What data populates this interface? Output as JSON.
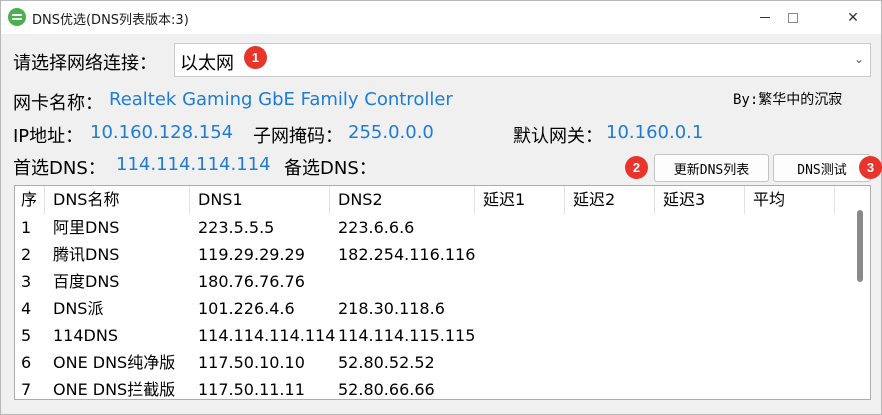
{
  "window": {
    "title": "DNS优选(DNS列表版本:3)",
    "icons": {
      "app": "dns-app-icon",
      "minimize": "minimize-icon",
      "maximize": "maximize-icon",
      "close": "close-icon"
    }
  },
  "adapter": {
    "label": "请选择网络连接：",
    "selected": "以太网",
    "badge": "1"
  },
  "nic": {
    "label": "网卡名称：",
    "value": "Realtek Gaming GbE Family Controller"
  },
  "author": "By:繁华中的沉寂",
  "ip": {
    "ip_label": "IP地址：",
    "ip_value": "10.160.128.154",
    "mask_label": "子网掩码：",
    "mask_value": "255.0.0.0",
    "gateway_label": "默认网关：",
    "gateway_value": "10.160.0.1"
  },
  "dns": {
    "primary_label": "首选DNS：",
    "primary_value": "114.114.114.114",
    "secondary_label": "备选DNS："
  },
  "buttons": {
    "update_badge": "2",
    "update_label": "更新DNS列表",
    "test_label": "DNS测试",
    "test_badge": "3"
  },
  "table": {
    "columns": [
      "序",
      "DNS名称",
      "DNS1",
      "DNS2",
      "延迟1",
      "延迟2",
      "延迟3",
      "平均"
    ],
    "rows": [
      [
        "1",
        "阿里DNS",
        "223.5.5.5",
        "223.6.6.6",
        "",
        "",
        "",
        ""
      ],
      [
        "2",
        "腾讯DNS",
        "119.29.29.29",
        "182.254.116.116",
        "",
        "",
        "",
        ""
      ],
      [
        "3",
        "百度DNS",
        "180.76.76.76",
        "",
        "",
        "",
        "",
        ""
      ],
      [
        "4",
        "DNS派",
        "101.226.4.6",
        "218.30.118.6",
        "",
        "",
        "",
        ""
      ],
      [
        "5",
        "114DNS",
        "114.114.114.114",
        "114.114.115.115",
        "",
        "",
        "",
        ""
      ],
      [
        "6",
        "ONE DNS纯净版",
        "117.50.10.10",
        "52.80.52.52",
        "",
        "",
        "",
        ""
      ],
      [
        "7",
        "ONE DNS拦截版",
        "117.50.11.11",
        "52.80.66.66",
        "",
        "",
        "",
        ""
      ]
    ]
  },
  "colors": {
    "value_text": "#1e7bd6",
    "badge": "#e8342b",
    "app_icon": "#4caf50"
  }
}
